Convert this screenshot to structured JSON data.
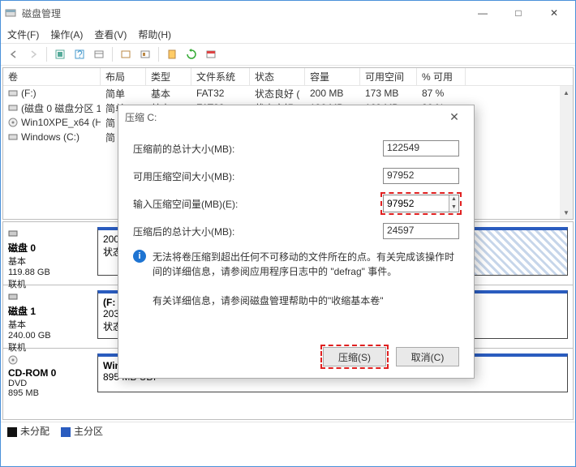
{
  "window": {
    "title": "磁盘管理"
  },
  "menu": {
    "file": "文件(F)",
    "action": "操作(A)",
    "view": "查看(V)",
    "help": "帮助(H)"
  },
  "columns": {
    "vol": "卷",
    "layout": "布局",
    "type": "类型",
    "fs": "文件系统",
    "status": "状态",
    "capacity": "容量",
    "free": "可用空间",
    "pct": "% 可用"
  },
  "rows": [
    {
      "vol": "(F:)",
      "layout": "简单",
      "type": "基本",
      "fs": "FAT32",
      "status": "状态良好 (",
      "cap": "200 MB",
      "free": "173 MB",
      "pct": "87 %"
    },
    {
      "vol": "(磁盘 0 磁盘分区 1)",
      "layout": "简单",
      "type": "基本",
      "fs": "FAT32",
      "status": "状态良好 (...",
      "cap": "196 MB",
      "free": "169 MB",
      "pct": "86 %"
    },
    {
      "vol": "Win10XPE_x64 (H:)",
      "layout": "简",
      "type": "",
      "fs": "",
      "status": "",
      "cap": "",
      "free": "",
      "pct": ""
    },
    {
      "vol": "Windows (C:)",
      "layout": "简",
      "type": "",
      "fs": "",
      "status": "",
      "cap": "",
      "free": "",
      "pct": ""
    }
  ],
  "disks": {
    "d0": {
      "name": "磁盘 0",
      "sub1": "基本",
      "sub2": "119.88 GB",
      "sub3": "联机",
      "p1": {
        "a": "200",
        "b": "状态"
      }
    },
    "d1": {
      "name": "磁盘 1",
      "sub1": "基本",
      "sub2": "240.00 GB",
      "sub3": "联机",
      "p1": {
        "a": "(F:",
        "b": "203",
        "c": "状态"
      }
    },
    "cd": {
      "name": "CD-ROM 0",
      "sub1": "DVD",
      "sub2": "895 MB",
      "p1": {
        "a": "Win10XPE_x64  (H:)",
        "b": "895 MB UDF"
      }
    }
  },
  "legend": {
    "un": "未分配",
    "pr": "主分区"
  },
  "dialog": {
    "title": "压缩 C:",
    "label_total_before": "压缩前的总计大小(MB):",
    "label_avail": "可用压缩空间大小(MB):",
    "label_input": "输入压缩空间量(MB)(E):",
    "label_total_after": "压缩后的总计大小(MB):",
    "val_total_before": "122549",
    "val_avail": "97952",
    "val_input": "97952",
    "val_total_after": "24597",
    "info1": "无法将卷压缩到超出任何不可移动的文件所在的点。有关完成该操作时间的详细信息，请参阅应用程序日志中的 \"defrag\" 事件。",
    "info2": "有关详细信息，请参阅磁盘管理帮助中的\"收缩基本卷\"",
    "btn_shrink": "压缩(S)",
    "btn_cancel": "取消(C)"
  }
}
